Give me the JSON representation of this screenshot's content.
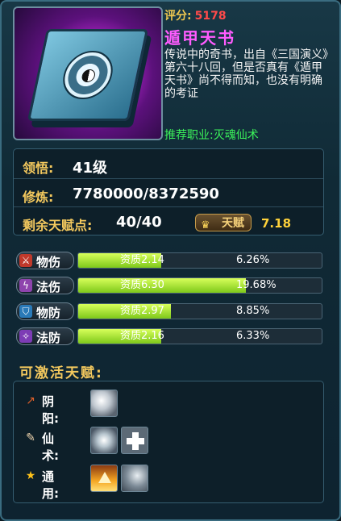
{
  "pet": {
    "score_label": "评分:",
    "score_value": "5178",
    "name": "遁甲天书",
    "description": "传说中的奇书，出自《三国演义》第六十八回，但是否真有《遁甲天书》尚不得而知，也没有明确的考证",
    "recommended": "推荐职业:灭魂仙术"
  },
  "stats": {
    "comprehension_label": "领悟:",
    "comprehension_value": "41级",
    "cultivation_label": "修炼:",
    "cultivation_value": "7780000/8372590",
    "talent_points_label": "剩余天赋点:",
    "talent_points_value": "40/40",
    "talent_button_label": "天赋",
    "talent_value": "7.18"
  },
  "aptitudes": [
    {
      "label": "物伤",
      "quality": "资质2.14",
      "percent": "6.26%",
      "fill_fraction": 0.34,
      "icon": "sword-icon",
      "icon_color": "#c0392b"
    },
    {
      "label": "法伤",
      "quality": "资质6.30",
      "percent": "19.68%",
      "fill_fraction": 0.69,
      "icon": "lightning-icon",
      "icon_color": "#8e44ad"
    },
    {
      "label": "物防",
      "quality": "资质2.97",
      "percent": "8.85%",
      "fill_fraction": 0.38,
      "icon": "shield-icon",
      "icon_color": "#2a7ab8"
    },
    {
      "label": "法防",
      "quality": "资质2.16",
      "percent": "6.33%",
      "fill_fraction": 0.34,
      "icon": "magic-shield-icon",
      "icon_color": "#7d3cb5"
    }
  ],
  "activatable": {
    "title": "可激活天赋:",
    "rows": [
      {
        "label": "阴阳:",
        "icon": "crescent-icon",
        "skills": [
          "swirl-skill-icon"
        ]
      },
      {
        "label": "仙术:",
        "icon": "brush-icon",
        "skills": [
          "burst-skill-icon",
          "cross-skill-icon"
        ]
      },
      {
        "label": "通用:",
        "icon": "star-icon",
        "skills": [
          "flame-arrow-skill-icon",
          "wolf-skill-icon"
        ]
      }
    ]
  },
  "colors": {
    "accent_gold": "#f4c95e",
    "score_red": "#ff4a4a",
    "name_magenta": "#ff5cff",
    "recommend_green": "#3bf25a",
    "bar_fill": "#a6e334"
  }
}
